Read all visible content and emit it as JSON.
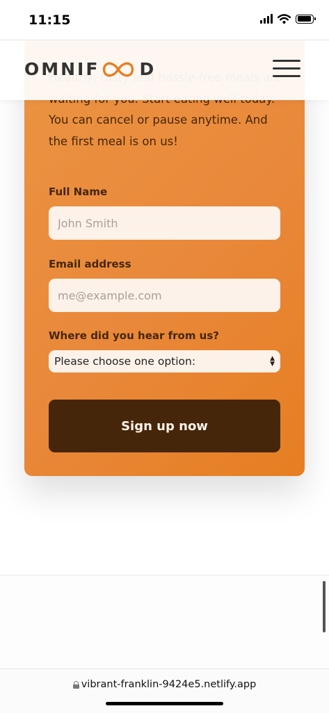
{
  "status_bar": {
    "time": "11:15"
  },
  "header": {
    "logo_left": "OMNIF",
    "logo_right": "D",
    "menu_icon": "hamburger-menu-icon"
  },
  "cta": {
    "text": "Healthy, tasty and hassle-free meals are waiting for you. Start eating well today. You can cancel or pause anytime. And the first meal is on us!",
    "full_name": {
      "label": "Full Name",
      "placeholder": "John Smith"
    },
    "email": {
      "label": "Email address",
      "placeholder": "me@example.com"
    },
    "source": {
      "label": "Where did you hear from us?",
      "selected": "Please choose one option:"
    },
    "submit_label": "Sign up now"
  },
  "browser": {
    "url": "vibrant-franklin-9424e5.netlify.app"
  },
  "colors": {
    "primary": "#e67e22",
    "primary_dark": "#45260a",
    "field_bg": "#fdf2e9"
  }
}
